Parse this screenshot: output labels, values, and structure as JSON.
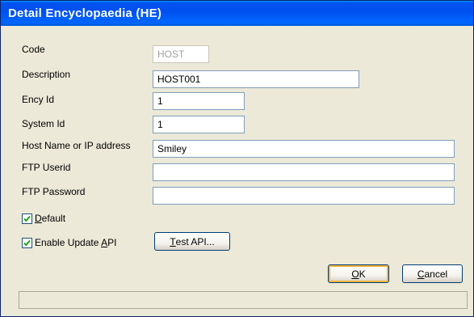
{
  "window": {
    "title": "Detail Encyclopaedia (HE)"
  },
  "form": {
    "code": {
      "label": "Code",
      "value": "HOST"
    },
    "description": {
      "label": "Description",
      "value": "HOST001"
    },
    "ency_id": {
      "label": "Ency Id",
      "value": "1"
    },
    "system_id": {
      "label": "System Id",
      "value": "1"
    },
    "host": {
      "label": "Host Name or IP address",
      "value": "Smiley"
    },
    "ftp_userid": {
      "label": "FTP Userid",
      "value": ""
    },
    "ftp_password": {
      "label": "FTP Password",
      "value": ""
    },
    "default_check": {
      "label_u": "D",
      "label_rest": "efault",
      "checked": true
    },
    "update_api_check": {
      "label_pre": "Enable Update ",
      "label_u": "A",
      "label_rest": "PI",
      "checked": true
    }
  },
  "buttons": {
    "test_api": {
      "label_u": "T",
      "label_rest": "est API..."
    },
    "ok": {
      "label_u": "O",
      "label_rest": "K"
    },
    "cancel": {
      "label_u": "C",
      "label_rest": "ancel"
    }
  },
  "statusbar": {
    "text": ""
  }
}
